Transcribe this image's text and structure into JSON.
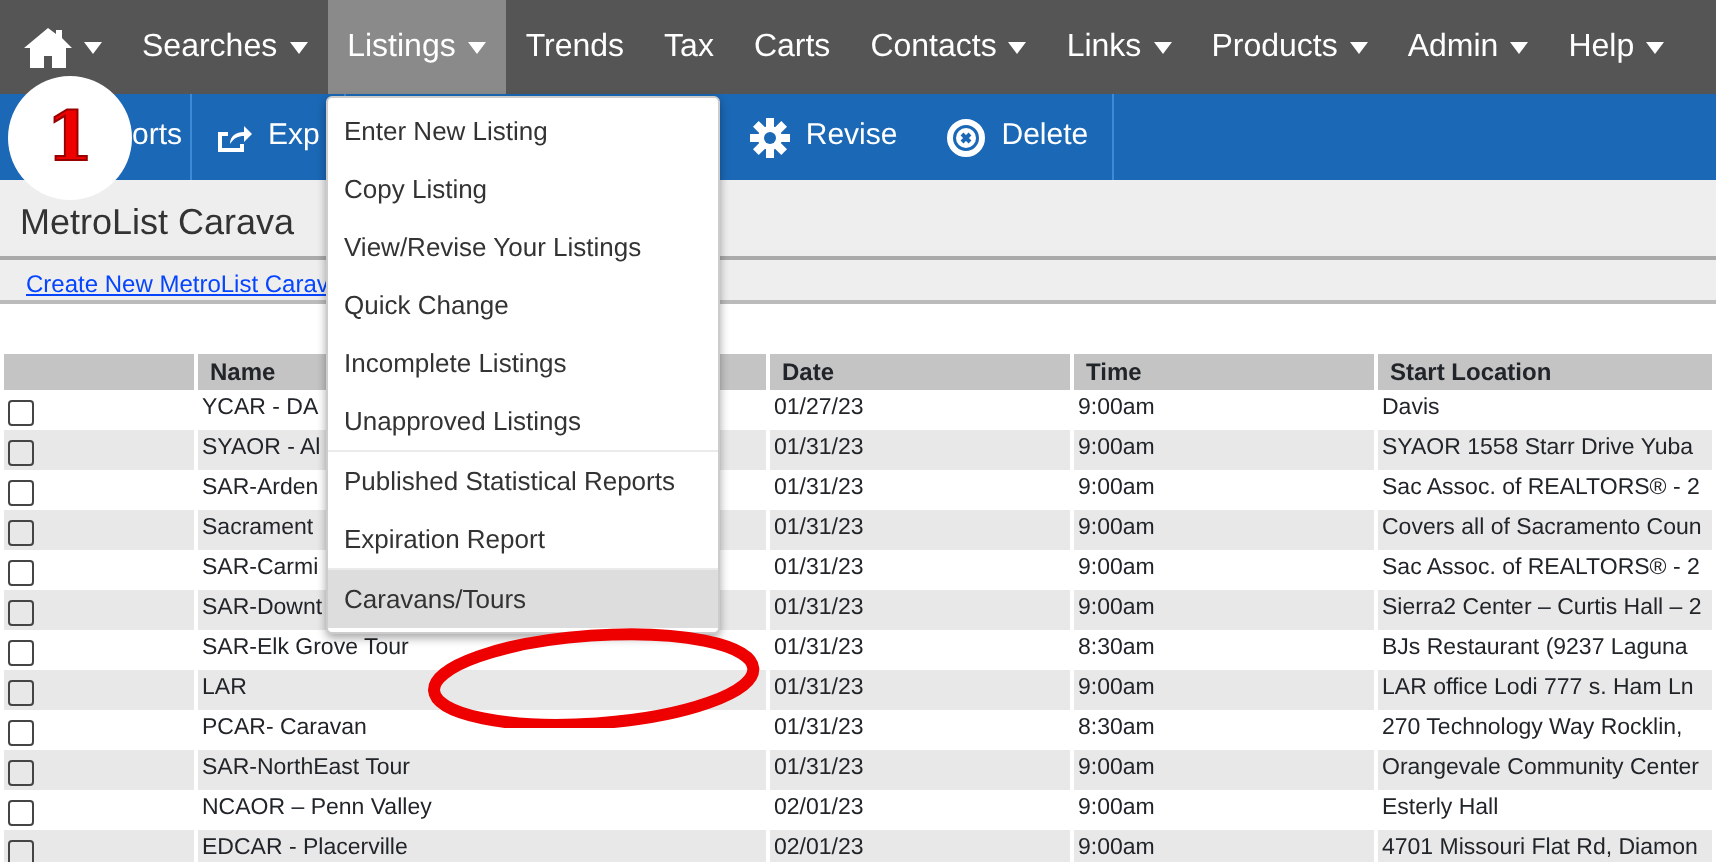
{
  "navbar": {
    "items": [
      {
        "label": "Searches",
        "dropdown": true,
        "selected": false
      },
      {
        "label": "Listings",
        "dropdown": true,
        "selected": true
      },
      {
        "label": "Trends",
        "dropdown": false,
        "selected": false
      },
      {
        "label": "Tax",
        "dropdown": false,
        "selected": false
      },
      {
        "label": "Carts",
        "dropdown": false,
        "selected": false
      },
      {
        "label": "Contacts",
        "dropdown": true,
        "selected": false
      },
      {
        "label": "Links",
        "dropdown": true,
        "selected": false
      },
      {
        "label": "Products",
        "dropdown": true,
        "selected": false
      },
      {
        "label": "Admin",
        "dropdown": true,
        "selected": false
      },
      {
        "label": "Help",
        "dropdown": true,
        "selected": false
      }
    ]
  },
  "step_badge": "1",
  "toolbar": [
    {
      "label": "orts",
      "kind": "reports"
    },
    {
      "label": "Exp",
      "kind": "export"
    },
    {
      "label": "Revise",
      "kind": "revise"
    },
    {
      "label": "Delete",
      "kind": "delete"
    }
  ],
  "page_title": "MetroList Carava",
  "create_link": "Create New MetroList Carav",
  "table": {
    "columns": [
      "Name",
      "Date",
      "Time",
      "Start Location"
    ],
    "rows": [
      {
        "checked": false,
        "cells": [
          "YCAR - DA",
          "01/27/23",
          "9:00am",
          "Davis"
        ]
      },
      {
        "checked": false,
        "cells": [
          "SYAOR - Al",
          "01/31/23",
          "9:00am",
          "SYAOR 1558 Starr Drive Yuba"
        ]
      },
      {
        "checked": false,
        "cells": [
          "SAR-Arden",
          "01/31/23",
          "9:00am",
          "Sac Assoc. of REALTORS® - 2"
        ]
      },
      {
        "checked": false,
        "cells": [
          "Sacrament",
          "01/31/23",
          "9:00am",
          "Covers all of Sacramento Coun"
        ]
      },
      {
        "checked": false,
        "cells": [
          "SAR-Carmi",
          "01/31/23",
          "9:00am",
          "Sac Assoc. of REALTORS® - 2"
        ]
      },
      {
        "checked": false,
        "cells": [
          "SAR-Downt",
          "01/31/23",
          "9:00am",
          "Sierra2 Center – Curtis Hall – 2"
        ]
      },
      {
        "checked": false,
        "cells": [
          "SAR-Elk Grove Tour",
          "01/31/23",
          "8:30am",
          "BJs Restaurant (9237 Laguna"
        ]
      },
      {
        "checked": false,
        "cells": [
          "LAR",
          "01/31/23",
          "9:00am",
          "LAR office Lodi 777 s. Ham Ln"
        ]
      },
      {
        "checked": false,
        "cells": [
          "PCAR- Caravan",
          "01/31/23",
          "8:30am",
          "270 Technology Way Rocklin,"
        ]
      },
      {
        "checked": false,
        "cells": [
          "SAR-NorthEast Tour",
          "01/31/23",
          "9:00am",
          "Orangevale Community Center"
        ]
      },
      {
        "checked": false,
        "cells": [
          "NCAOR – Penn Valley",
          "02/01/23",
          "9:00am",
          "Esterly Hall"
        ]
      },
      {
        "checked": false,
        "cells": [
          "EDCAR - Placerville",
          "02/01/23",
          "9:00am",
          "4701 Missouri Flat Rd, Diamon"
        ]
      }
    ]
  },
  "dropdown_menu": [
    {
      "label": "Enter New Listing",
      "divider_after": false,
      "selected": false
    },
    {
      "label": "Copy Listing",
      "divider_after": false,
      "selected": false
    },
    {
      "label": "View/Revise Your Listings",
      "divider_after": false,
      "selected": false
    },
    {
      "label": "Quick Change",
      "divider_after": false,
      "selected": false
    },
    {
      "label": "Incomplete Listings",
      "divider_after": false,
      "selected": false
    },
    {
      "label": "Unapproved Listings",
      "divider_after": true,
      "selected": false
    },
    {
      "label": "Published Statistical Reports",
      "divider_after": false,
      "selected": false
    },
    {
      "label": "Expiration Report",
      "divider_after": true,
      "selected": false
    },
    {
      "label": "Caravans/Tours",
      "divider_after": false,
      "selected": true
    }
  ]
}
